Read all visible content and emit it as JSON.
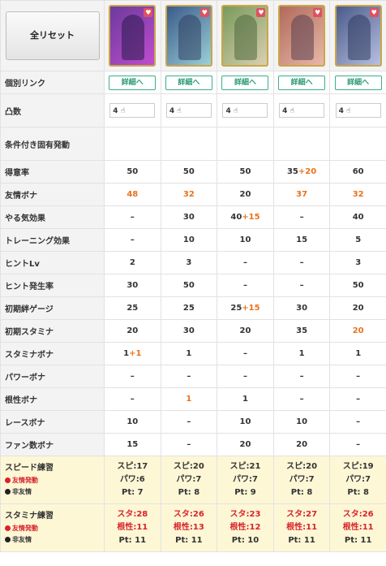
{
  "reset_label": "全リセット",
  "cards": [
    {
      "name": "card-1",
      "colors": [
        "#6b3a9c",
        "#c04dd0",
        "#2a1a4a"
      ]
    },
    {
      "name": "card-2",
      "colors": [
        "#3a5a8a",
        "#9bd0d8",
        "#304060"
      ]
    },
    {
      "name": "card-3",
      "colors": [
        "#7a9a5a",
        "#d8d0b0",
        "#506a40"
      ]
    },
    {
      "name": "card-4",
      "colors": [
        "#b06a5a",
        "#e8b8a8",
        "#5a4050"
      ]
    },
    {
      "name": "card-5",
      "colors": [
        "#4a5a8a",
        "#b8c0e0",
        "#303a60"
      ]
    }
  ],
  "detail_label": "詳細へ",
  "labels": {
    "link": "個別リンク",
    "limit": "凸数",
    "unique": "条件付き固有発動",
    "tokui": "得意率",
    "yujo": "友情ボナ",
    "yaruki": "やる気効果",
    "training": "トレーニング効果",
    "hintlv": "ヒントLv",
    "hintrate": "ヒント発生率",
    "kizuna": "初期絆ゲージ",
    "init_sta": "初期スタミナ",
    "sta_bona": "スタミナボナ",
    "pow_bona": "パワーボナ",
    "kon_bona": "根性ボナ",
    "race_bona": "レースボナ",
    "fan_bona": "ファン数ボナ"
  },
  "limit_value": "4",
  "rows": {
    "tokui": [
      [
        "50"
      ],
      [
        "50"
      ],
      [
        "50"
      ],
      [
        "35",
        "+20"
      ],
      [
        "60"
      ]
    ],
    "yujo": [
      [
        "",
        "48"
      ],
      [
        "",
        "32"
      ],
      [
        "20"
      ],
      [
        "",
        "37"
      ],
      [
        "",
        "32"
      ]
    ],
    "yaruki": [
      [
        "–"
      ],
      [
        "30"
      ],
      [
        "40",
        "+15"
      ],
      [
        "–"
      ],
      [
        "40"
      ]
    ],
    "training": [
      [
        "–"
      ],
      [
        "10"
      ],
      [
        "10"
      ],
      [
        "15"
      ],
      [
        "5"
      ]
    ],
    "hintlv": [
      [
        "2"
      ],
      [
        "3"
      ],
      [
        "–"
      ],
      [
        "–"
      ],
      [
        "3"
      ]
    ],
    "hintrate": [
      [
        "30"
      ],
      [
        "50"
      ],
      [
        "–"
      ],
      [
        "–"
      ],
      [
        "50"
      ]
    ],
    "kizuna": [
      [
        "25"
      ],
      [
        "25"
      ],
      [
        "25",
        "+15"
      ],
      [
        "30"
      ],
      [
        "20"
      ]
    ],
    "init_sta": [
      [
        "20"
      ],
      [
        "30"
      ],
      [
        "20"
      ],
      [
        "35"
      ],
      [
        "",
        "20"
      ]
    ],
    "sta_bona": [
      [
        "1",
        "+1"
      ],
      [
        "1"
      ],
      [
        "–"
      ],
      [
        "1"
      ],
      [
        "1"
      ]
    ],
    "pow_bona": [
      [
        "–"
      ],
      [
        "–"
      ],
      [
        "–"
      ],
      [
        "–"
      ],
      [
        "–"
      ]
    ],
    "kon_bona": [
      [
        "–"
      ],
      [
        "",
        "1"
      ],
      [
        "1"
      ],
      [
        "–"
      ],
      [
        "–"
      ]
    ],
    "race_bona": [
      [
        "10"
      ],
      [
        "–"
      ],
      [
        "10"
      ],
      [
        "10"
      ],
      [
        "–"
      ]
    ],
    "fan_bona": [
      [
        "15"
      ],
      [
        "–"
      ],
      [
        "20"
      ],
      [
        "20"
      ],
      [
        "–"
      ]
    ]
  },
  "practice": {
    "legend_yujo": "友情発動",
    "legend_hiyujo": "非友情",
    "speed": {
      "title": "スピード練習",
      "cells": [
        [
          "スピ:17",
          "パワ:6",
          "Pt: 7"
        ],
        [
          "スピ:20",
          "パワ:7",
          "Pt: 8"
        ],
        [
          "スピ:21",
          "パワ:7",
          "Pt: 9"
        ],
        [
          "スピ:20",
          "パワ:7",
          "Pt: 8"
        ],
        [
          "スピ:19",
          "パワ:7",
          "Pt: 8"
        ]
      ]
    },
    "stamina": {
      "title": "スタミナ練習",
      "cells": [
        [
          "スタ:28",
          "根性:11",
          "Pt: 11"
        ],
        [
          "スタ:26",
          "根性:13",
          "Pt: 11"
        ],
        [
          "スタ:23",
          "根性:12",
          "Pt: 10"
        ],
        [
          "スタ:27",
          "根性:11",
          "Pt: 11"
        ],
        [
          "スタ:26",
          "根性:11",
          "Pt: 11"
        ]
      ]
    }
  },
  "colors": {
    "orange": "#e8731c",
    "red": "#d8232a",
    "accent": "#3ab08a",
    "practice_bg": "#fdf7d6"
  }
}
